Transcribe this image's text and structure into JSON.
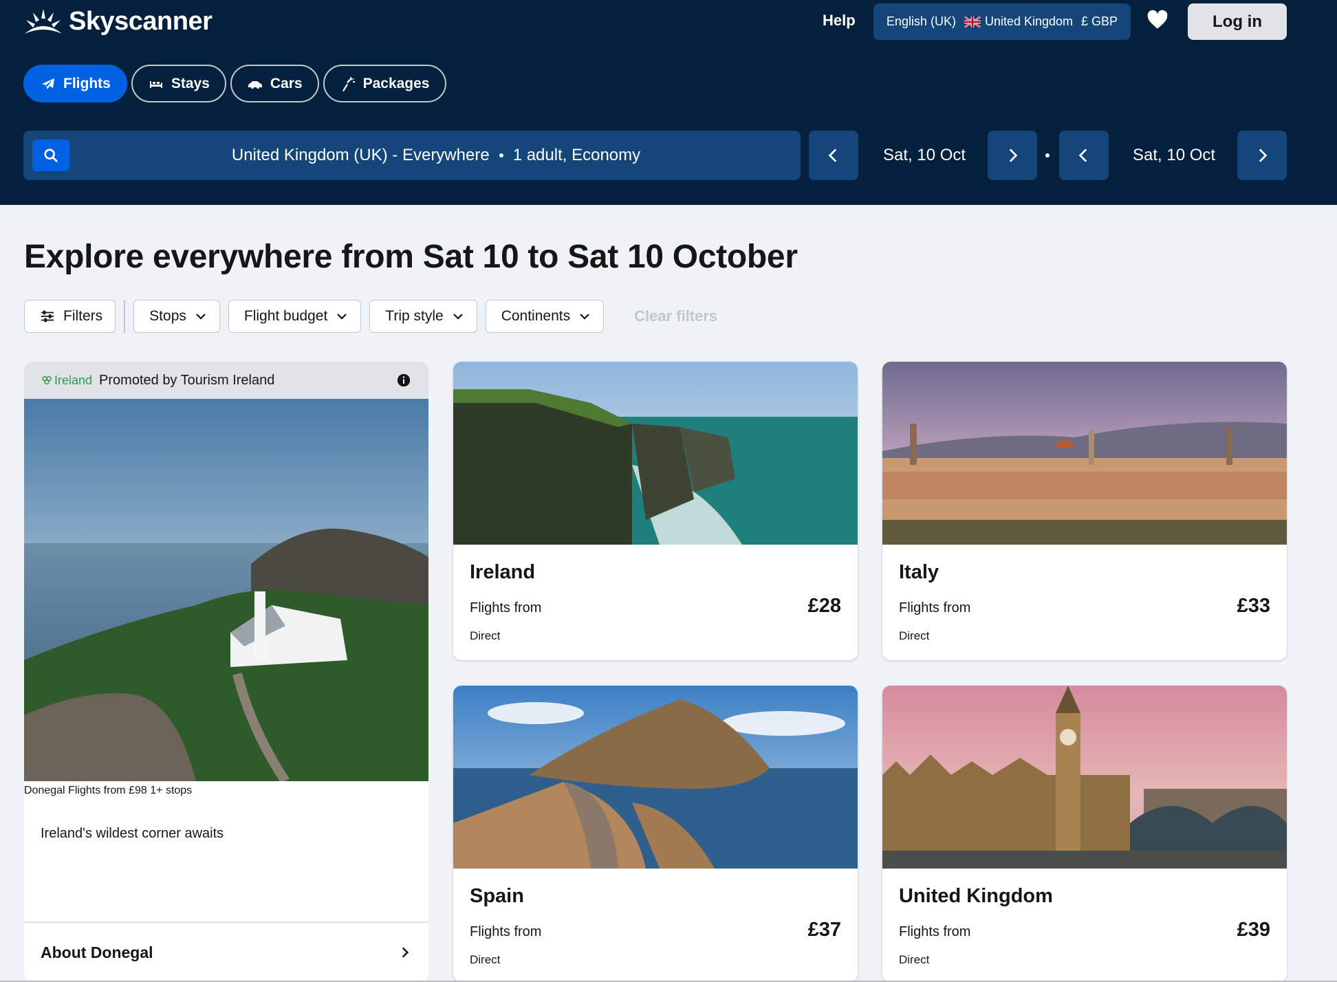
{
  "header": {
    "brand": "Skyscanner",
    "help": "Help",
    "locale": {
      "language": "English (UK)",
      "country": "United Kingdom",
      "currency": "£ GBP"
    },
    "login": "Log in",
    "tabs": [
      {
        "label": "Flights",
        "icon": "plane-icon",
        "active": true
      },
      {
        "label": "Stays",
        "icon": "bed-icon",
        "active": false
      },
      {
        "label": "Cars",
        "icon": "car-icon",
        "active": false
      },
      {
        "label": "Packages",
        "icon": "packages-icon",
        "active": false
      }
    ],
    "search": {
      "route": "United Kingdom (UK) - Everywhere",
      "travellers": "1 adult, Economy"
    },
    "depart_date": "Sat, 10 Oct",
    "return_date": "Sat, 10 Oct"
  },
  "main": {
    "title": "Explore everywhere from Sat 10 to Sat 10 October",
    "filters": {
      "filters": "Filters",
      "stops": "Stops",
      "budget": "Flight budget",
      "trip_style": "Trip style",
      "continents": "Continents",
      "clear": "Clear filters"
    },
    "promo": {
      "brand": "Ireland",
      "promoted_by": "Promoted by Tourism Ireland",
      "name": "Donegal",
      "tagline": "Ireland's wildest corner awaits",
      "from": "Flights from",
      "price": "£98",
      "stops": "1+ stops",
      "about": "About Donegal"
    },
    "destinations": [
      {
        "name": "Ireland",
        "from": "Flights from",
        "price": "£28",
        "stops": "Direct"
      },
      {
        "name": "Italy",
        "from": "Flights from",
        "price": "£33",
        "stops": "Direct"
      },
      {
        "name": "Spain",
        "from": "Flights from",
        "price": "£37",
        "stops": "Direct"
      },
      {
        "name": "United Kingdom",
        "from": "Flights from",
        "price": "£39",
        "stops": "Direct"
      }
    ]
  },
  "colors": {
    "header_bg": "#05203c",
    "primary": "#0062e3",
    "page_bg": "#eff3f8"
  }
}
